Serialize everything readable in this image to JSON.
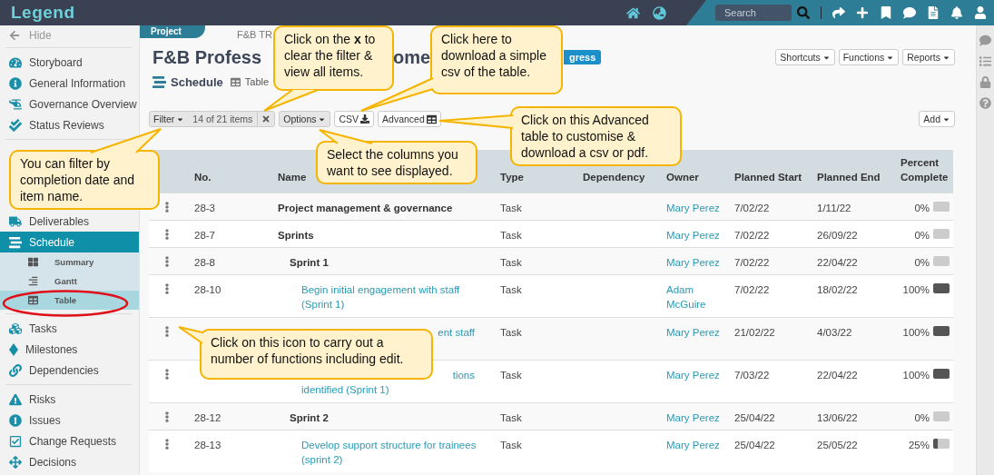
{
  "app": {
    "logo": "Legend",
    "search": {
      "placeholder": "Search"
    }
  },
  "sidebar": {
    "hide": "Hide",
    "sections": [
      {
        "items": [
          {
            "label": "Storyboard",
            "selected": false
          },
          {
            "label": "General Information",
            "selected": false
          },
          {
            "label": "Governance Overview",
            "selected": false
          },
          {
            "label": "Status Reviews",
            "selected": false
          }
        ]
      },
      {
        "items": [
          {
            "label": "Deliverables",
            "selected": false
          },
          {
            "label": "Schedule",
            "selected": true,
            "children": [
              {
                "label": "Summary",
                "selected": false
              },
              {
                "label": "Gantt",
                "selected": false
              },
              {
                "label": "Table",
                "selected": true
              }
            ]
          }
        ]
      },
      {
        "items": [
          {
            "label": "Tasks",
            "selected": false
          },
          {
            "label": "Milestones",
            "selected": false
          },
          {
            "label": "Dependencies",
            "selected": false
          }
        ]
      },
      {
        "items": [
          {
            "label": "Risks",
            "selected": false
          },
          {
            "label": "Issues",
            "selected": false
          },
          {
            "label": "Change Requests",
            "selected": false
          },
          {
            "label": "Decisions",
            "selected": false
          }
        ]
      }
    ]
  },
  "header": {
    "tab": "Project",
    "breadcrumb": "F&B TR",
    "title_parts": [
      "F&B Profess",
      "ome"
    ],
    "status_badge": "gress",
    "buttons": [
      {
        "label": "Shortcuts"
      },
      {
        "label": "Functions"
      },
      {
        "label": "Reports"
      }
    ]
  },
  "view": {
    "heading": "Schedule",
    "tab": "Table"
  },
  "toolbar": {
    "filter": "Filter",
    "count": "14 of 21 items",
    "options": "Options",
    "csv": "CSV",
    "advanced": "Advanced",
    "add": "Add"
  },
  "table": {
    "columns": [
      "No.",
      "Name",
      "Type",
      "Dependency",
      "Owner",
      "Planned Start",
      "Planned End",
      "Percent Complete"
    ],
    "rows": [
      {
        "no": "28-3",
        "kind": "summary",
        "name": "Project management & governance",
        "type": "Task",
        "owner": "Mary Perez",
        "start": "7/02/22",
        "end": "1/11/22",
        "percent": "0%",
        "level": 0
      },
      {
        "no": "28-7",
        "kind": "summary",
        "name": "Sprints",
        "type": "Task",
        "owner": "Mary Perez",
        "start": "7/02/22",
        "end": "26/09/22",
        "percent": "0%",
        "level": 0,
        "children": [
          {
            "no": "28-8",
            "kind": "summary",
            "name": "Sprint 1",
            "type": "Task",
            "owner": "Mary Perez",
            "start": "7/02/22",
            "end": "22/04/22",
            "percent": "0%",
            "level": 0,
            "children": [
              {
                "no": "28-10",
                "kind": "task",
                "name": "Begin initial engagement with staff (Sprint 1)",
                "type": "Task",
                "owner": "Adam McGuire",
                "start": "7/02/22",
                "end": "18/02/22",
                "percent": "100%",
                "level": 1
              },
              {
                "kind": "task",
                "covered": true,
                "name_parts": [
                  "ent staff"
                ],
                "type": "Task",
                "owner": "Mary Perez",
                "start": "21/02/22",
                "end": "4/03/22",
                "percent": "100%",
                "level": 1
              },
              {
                "kind": "task",
                "covered": true,
                "name_parts": [
                  "tions",
                  "identified (Sprint 1)"
                ],
                "type": "Task",
                "owner": "Mary Perez",
                "start": "7/03/22",
                "end": "22/04/22",
                "percent": "100%",
                "level": 1
              }
            ]
          },
          {
            "no": "28-12",
            "kind": "summary",
            "name": "Sprint 2",
            "type": "Task",
            "owner": "Mary Perez",
            "start": "25/04/22",
            "end": "13/06/22",
            "percent": "0%",
            "level": 0,
            "children": [
              {
                "no": "28-13",
                "kind": "task",
                "name": "Develop support structure for trainees (sprint 2)",
                "type": "Task",
                "owner": "Mary Perez",
                "start": "25/04/22",
                "end": "25/05/22",
                "percent": "25%",
                "level": 0.25
              }
            ]
          }
        ]
      }
    ]
  },
  "callouts": [
    {
      "text": "Click on the **x** to clear the filter & view all items."
    },
    {
      "text": "Click here to download a simple csv of the table."
    },
    {
      "text": "Click on this Advanced table to customise & download a csv or pdf."
    },
    {
      "text": "Select the columns you want to see displayed."
    },
    {
      "text": "You can filter by completion date and item name."
    },
    {
      "text": "Click on this icon to carry out a number of functions including edit."
    }
  ]
}
